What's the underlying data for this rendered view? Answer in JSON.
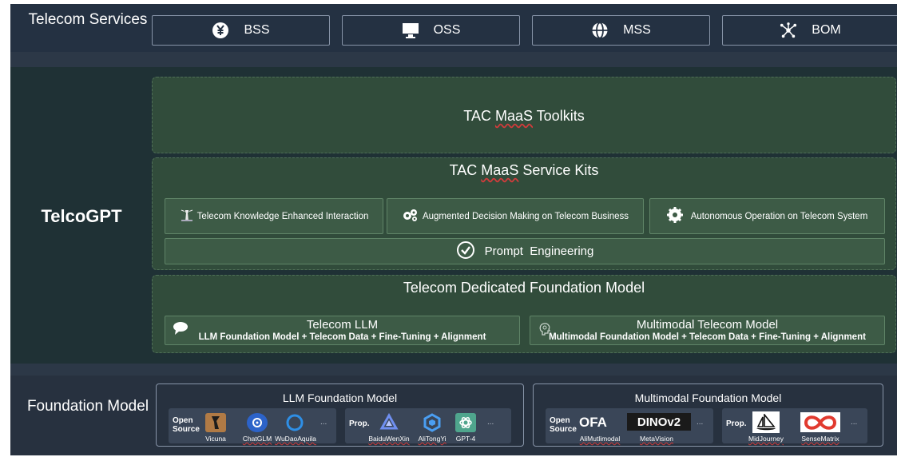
{
  "telecom_services": {
    "label": "Telecom Services",
    "items": [
      {
        "label": "BSS",
        "icon": "yuan-coin-icon"
      },
      {
        "label": "OSS",
        "icon": "monitor-icon"
      },
      {
        "label": "MSS",
        "icon": "globe-icon"
      },
      {
        "label": "BOM",
        "icon": "network-nodes-icon"
      }
    ]
  },
  "telcogpt": {
    "label": "TelcoGPT",
    "toolkits": {
      "prefix": "TAC ",
      "maas": "MaaS",
      "suffix": " Toolkits"
    },
    "service_kits": {
      "prefix": "TAC ",
      "maas": "MaaS",
      "suffix": " Service Kits",
      "items": [
        {
          "label": "Telecom Knowledge Enhanced Interaction",
          "icon": "lighthouse-icon"
        },
        {
          "label": "Augmented Decision Making on Telecom Business",
          "icon": "gears-icon"
        },
        {
          "label": "Autonomous Operation on Telecom System",
          "icon": "gear-icon"
        }
      ],
      "prompt": {
        "label": "Prompt  Engineering",
        "icon": "check-circle-icon"
      }
    },
    "dedicated": {
      "title": "Telecom Dedicated Foundation Model",
      "llm": {
        "title": "Telecom LLM",
        "subtitle": "LLM Foundation Model + Telecom Data + Fine-Tuning + Alignment",
        "icon": "speech-bubble-icon"
      },
      "multimodal": {
        "title": "Multimodal Telecom Model",
        "subtitle": "Multimodal Foundation Model + Telecom Data + Fine-Tuning + Alignment",
        "icon": "head-idea-icon"
      }
    }
  },
  "foundation": {
    "label": "Foundation Model",
    "llm": {
      "title": "LLM Foundation Model",
      "open_source": {
        "label_line1": "Open",
        "label_line2": "Source",
        "models": [
          "Vicuna",
          "ChatGLM",
          "WuDaoAquila"
        ],
        "more": "..."
      },
      "prop": {
        "label": "Prop.",
        "models": [
          "BaiduWenXin",
          "AliTongYi",
          "GPT-4"
        ],
        "more": "..."
      }
    },
    "multimodal": {
      "title": "Multimodal Foundation Model",
      "open_source": {
        "label_line1": "Open",
        "label_line2": "Source",
        "models": [
          "AliMutlimodal",
          "MetaVision"
        ],
        "logos": [
          "OFA",
          "DINOv2"
        ],
        "more": "..."
      },
      "prop": {
        "label": "Prop.",
        "models": [
          "MidJourney",
          "SenseMatrix"
        ],
        "more": "..."
      }
    }
  },
  "colors": {
    "services_bg": "#243142",
    "telcogpt_bg": "#1f3135",
    "green_panel": "#314c3b",
    "green_item": "#3d5b46",
    "spellcheck_underline": "#d23b3b"
  }
}
